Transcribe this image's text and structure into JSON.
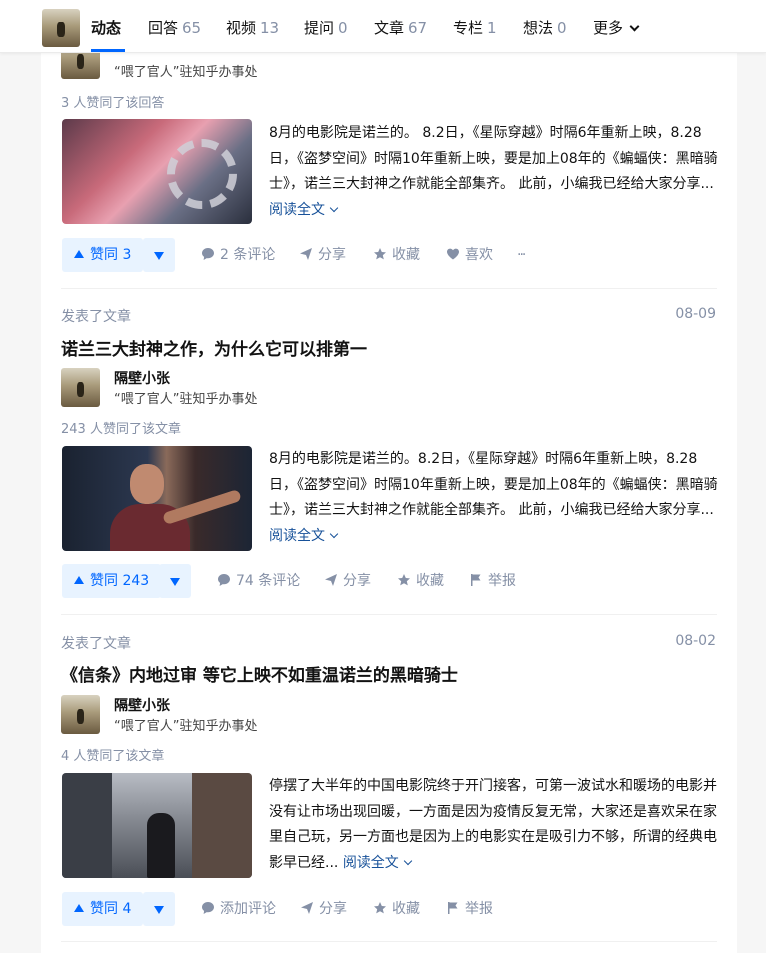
{
  "nav": {
    "tabs": [
      {
        "label": "动态",
        "count": ""
      },
      {
        "label": "回答",
        "count": "65"
      },
      {
        "label": "视频",
        "count": "13"
      },
      {
        "label": "提问",
        "count": "0"
      },
      {
        "label": "文章",
        "count": "67"
      },
      {
        "label": "专栏",
        "count": "1"
      },
      {
        "label": "想法",
        "count": "0"
      },
      {
        "label": "更多",
        "count": ""
      }
    ]
  },
  "items": [
    {
      "author_bio": "“喂了官人”驻知乎办事处",
      "votes_line": "3 人赞同了该回答",
      "excerpt": "8月的电影院是诺兰的。 8.2日，《星际穿越》时隔6年重新上映，8.28日，《盗梦空间》时隔10年重新上映，要是加上08年的《蝙蝠侠：黑暗骑士》，诺兰三大封神之作就能全部集齐。 此前，小编我已经给大家分享...",
      "read_more": "阅读全文",
      "vote_label": "赞同 3",
      "actions": [
        "2 条评论",
        "分享",
        "收藏",
        "喜欢",
        "···"
      ]
    },
    {
      "meta": "发表了文章",
      "date": "08-09",
      "title": "诺兰三大封神之作，为什么它可以排第一",
      "author_name": "隔壁小张",
      "author_bio": "“喂了官人”驻知乎办事处",
      "votes_line": "243 人赞同了该文章",
      "excerpt": "8月的电影院是诺兰的。8.2日，《星际穿越》时隔6年重新上映，8.28日，《盗梦空间》时隔10年重新上映，要是加上08年的《蝙蝠侠：黑暗骑士》，诺兰三大封神之作就能全部集齐。 此前，小编我已经给大家分享...",
      "read_more": "阅读全文",
      "vote_label": "赞同 243",
      "actions": [
        "74 条评论",
        "分享",
        "收藏",
        "举报"
      ]
    },
    {
      "meta": "发表了文章",
      "date": "08-02",
      "title": "《信条》内地过审 等它上映不如重温诺兰的黑暗骑士",
      "author_name": "隔壁小张",
      "author_bio": "“喂了官人”驻知乎办事处",
      "votes_line": "4 人赞同了该文章",
      "excerpt": "停摆了大半年的中国电影院终于开门接客，可第一波试水和暖场的电影并没有让市场出现回暖，一方面是因为疫情反复无常，大家还是喜欢呆在家里自己玩，另一方面也是因为上的电影实在是吸引力不够，所谓的经典电影早已经...",
      "read_more": "阅读全文",
      "vote_label": "赞同 4",
      "actions": [
        "添加评论",
        "分享",
        "收藏",
        "举报"
      ]
    }
  ]
}
